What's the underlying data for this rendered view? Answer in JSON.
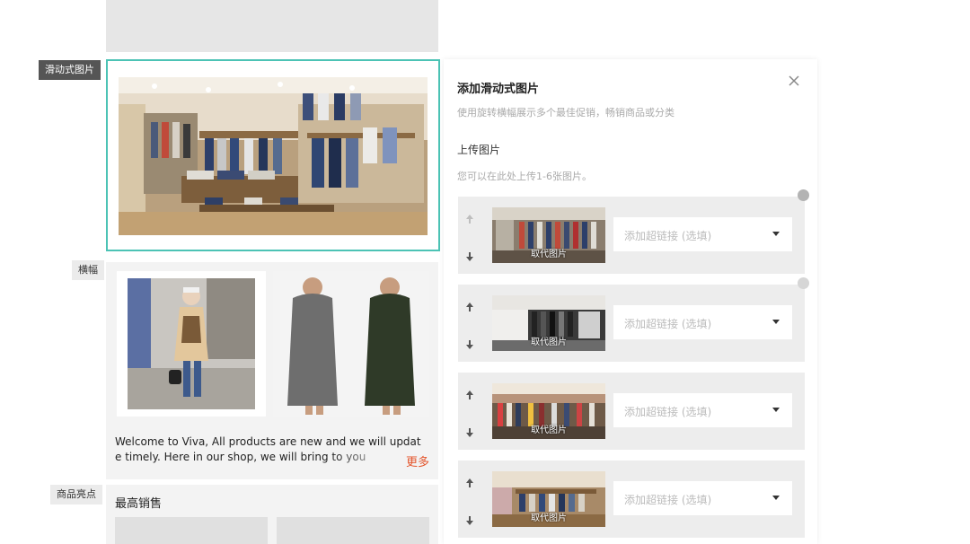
{
  "left_labels": {
    "slider": "滑动式图片",
    "banner": "横幅",
    "highlights": "商品亮点"
  },
  "banner": {
    "text_line1": "Welcome to Viva, All products are new and we will updat",
    "text_line2": "e timely. Here in our shop, we will bring to you",
    "more": "更多"
  },
  "best_sellers": {
    "title": "最高销售"
  },
  "panel": {
    "title": "添加滑动式图片",
    "description": "使用旋转横幅展示多个最佳促销，畅销商品或分类",
    "upload_title": "上传图片",
    "upload_hint": "您可以在此处上传1-6张图片。",
    "rows": [
      {
        "replace_label": "取代图片",
        "link_placeholder": "添加超链接 (选填)"
      },
      {
        "replace_label": "取代图片",
        "link_placeholder": "添加超链接 (选填)"
      },
      {
        "replace_label": "取代图片",
        "link_placeholder": "添加超链接 (选填)"
      },
      {
        "replace_label": "取代图片",
        "link_placeholder": "添加超链接 (选填)"
      }
    ]
  },
  "icons": {
    "close": "close-icon",
    "up": "arrow-up-icon",
    "down": "arrow-down-icon",
    "dropdown": "chevron-down-icon",
    "remove": "remove-dot-icon"
  },
  "colors": {
    "selected_border": "#4cc3b5",
    "more_link": "#e4572e",
    "active_tag": "#555555"
  }
}
